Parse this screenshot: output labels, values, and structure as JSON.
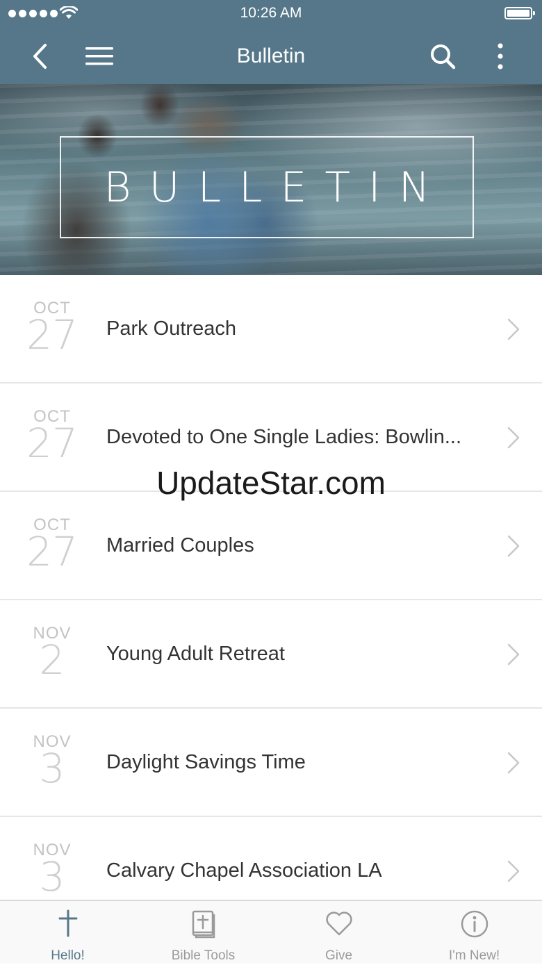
{
  "status_bar": {
    "time": "10:26 AM"
  },
  "navbar": {
    "title": "Bulletin"
  },
  "hero": {
    "title": "BULLETIN"
  },
  "items": [
    {
      "month": "OCT",
      "day": "27",
      "title": "Park Outreach"
    },
    {
      "month": "OCT",
      "day": "27",
      "title": "Devoted to One Single Ladies: Bowlin..."
    },
    {
      "month": "OCT",
      "day": "27",
      "title": "Married Couples"
    },
    {
      "month": "NOV",
      "day": "2",
      "title": "Young Adult Retreat"
    },
    {
      "month": "NOV",
      "day": "3",
      "title": "Daylight Savings Time"
    },
    {
      "month": "NOV",
      "day": "3",
      "title": "Calvary Chapel Association LA"
    }
  ],
  "watermark": "UpdateStar.com",
  "tabs": [
    {
      "label": "Hello!",
      "icon": "cross-icon",
      "active": true
    },
    {
      "label": "Bible Tools",
      "icon": "bible-icon",
      "active": false
    },
    {
      "label": "Give",
      "icon": "heart-icon",
      "active": false
    },
    {
      "label": "I'm New!",
      "icon": "info-icon",
      "active": false
    }
  ],
  "colors": {
    "header": "#557789",
    "accent": "#557789",
    "inactive_tab": "#9a9a9a",
    "date_text": "#c3c3c3"
  }
}
